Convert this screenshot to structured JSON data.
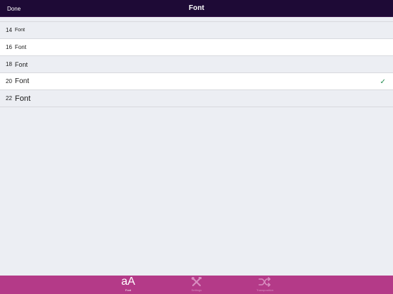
{
  "navbar": {
    "done_label": "Done",
    "title": "Font"
  },
  "font_list": {
    "items": [
      {
        "size": "14",
        "label": "Font",
        "selected": false
      },
      {
        "size": "16",
        "label": "Font",
        "selected": false
      },
      {
        "size": "18",
        "label": "Font",
        "selected": false
      },
      {
        "size": "20",
        "label": "Font",
        "selected": true
      },
      {
        "size": "22",
        "label": "Font",
        "selected": false
      }
    ],
    "check_glyph": "✓"
  },
  "tabbar": {
    "tabs": [
      {
        "icon": "aA",
        "icon_name": "font-size-icon",
        "label": "Font",
        "active": true
      },
      {
        "icon_name": "tools-icon",
        "label": "Settings",
        "active": false
      },
      {
        "icon_name": "shuffle-icon",
        "label": "Transposition",
        "active": false
      }
    ]
  },
  "colors": {
    "navbar_bg": "#1e0a36",
    "tabbar_bg": "#b43a88",
    "check": "#1f8a4c"
  }
}
